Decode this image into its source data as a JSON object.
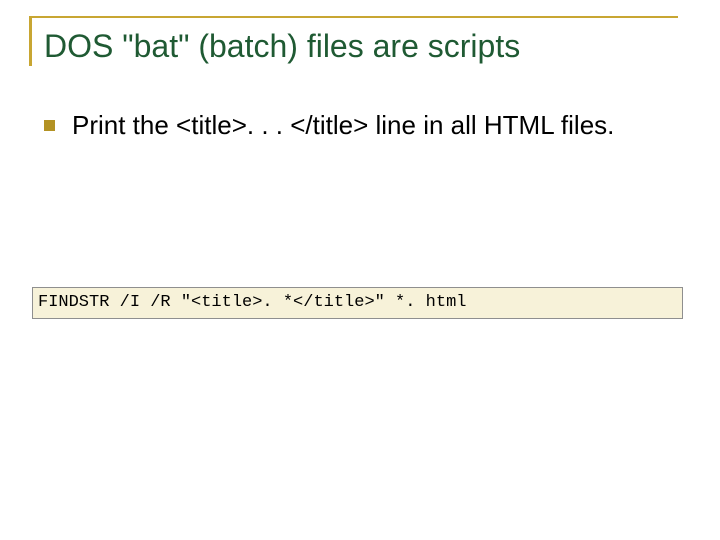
{
  "slide": {
    "title": "DOS \"bat\" (batch) files are scripts",
    "bullets": [
      {
        "text": "Print the <title>. . . </title> line in all HTML files."
      }
    ],
    "code": {
      "command": "FINDSTR /I /R \"<title>. *</title>\" *. html"
    }
  },
  "colors": {
    "accent": "#c8a632",
    "title_text": "#1f5a33",
    "bullet_marker": "#b39223",
    "code_background": "#f7f2d9",
    "code_border": "#8f8f8f"
  },
  "icons": {
    "bullet": "square-bullet-icon"
  }
}
